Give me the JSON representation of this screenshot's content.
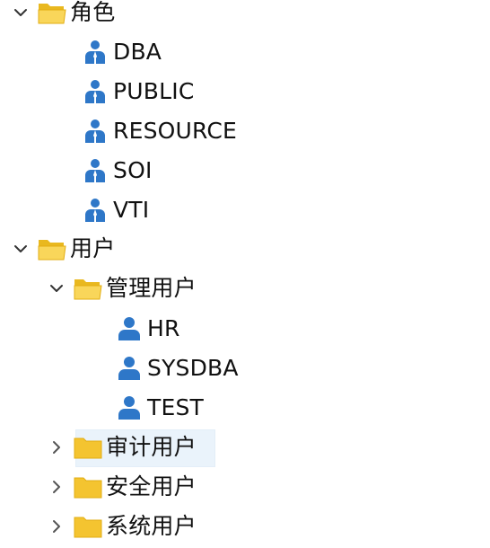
{
  "tree": {
    "nodes": [
      {
        "key": "roles",
        "label": "角色",
        "type": "folder",
        "expanded": true,
        "chevron": "chevron-down-icon"
      },
      {
        "key": "role-dba",
        "label": "DBA",
        "type": "role"
      },
      {
        "key": "role-public",
        "label": "PUBLIC",
        "type": "role"
      },
      {
        "key": "role-resource",
        "label": "RESOURCE",
        "type": "role"
      },
      {
        "key": "role-soi",
        "label": "SOI",
        "type": "role"
      },
      {
        "key": "role-vti",
        "label": "VTI",
        "type": "role"
      },
      {
        "key": "users",
        "label": "用户",
        "type": "folder",
        "expanded": true,
        "chevron": "chevron-down-icon"
      },
      {
        "key": "admin-users",
        "label": "管理用户",
        "type": "folder",
        "expanded": true,
        "chevron": "chevron-down-icon"
      },
      {
        "key": "user-hr",
        "label": "HR",
        "type": "user"
      },
      {
        "key": "user-sysdba",
        "label": "SYSDBA",
        "type": "user"
      },
      {
        "key": "user-test",
        "label": "TEST",
        "type": "user"
      },
      {
        "key": "audit-users",
        "label": "审计用户",
        "type": "folder",
        "expanded": false,
        "selected": true,
        "chevron": "chevron-right-icon"
      },
      {
        "key": "security-users",
        "label": "安全用户",
        "type": "folder",
        "expanded": false,
        "chevron": "chevron-right-icon"
      },
      {
        "key": "system-users",
        "label": "系统用户",
        "type": "folder",
        "expanded": false,
        "chevron": "chevron-right-icon"
      }
    ]
  },
  "colors": {
    "folder": "#f4c430",
    "folder_open_front": "#f9d65a",
    "role_icon": "#2e77c8",
    "user_icon": "#2e77c8",
    "selection_bg": "#eaf3fb",
    "chevron": "#333333"
  }
}
